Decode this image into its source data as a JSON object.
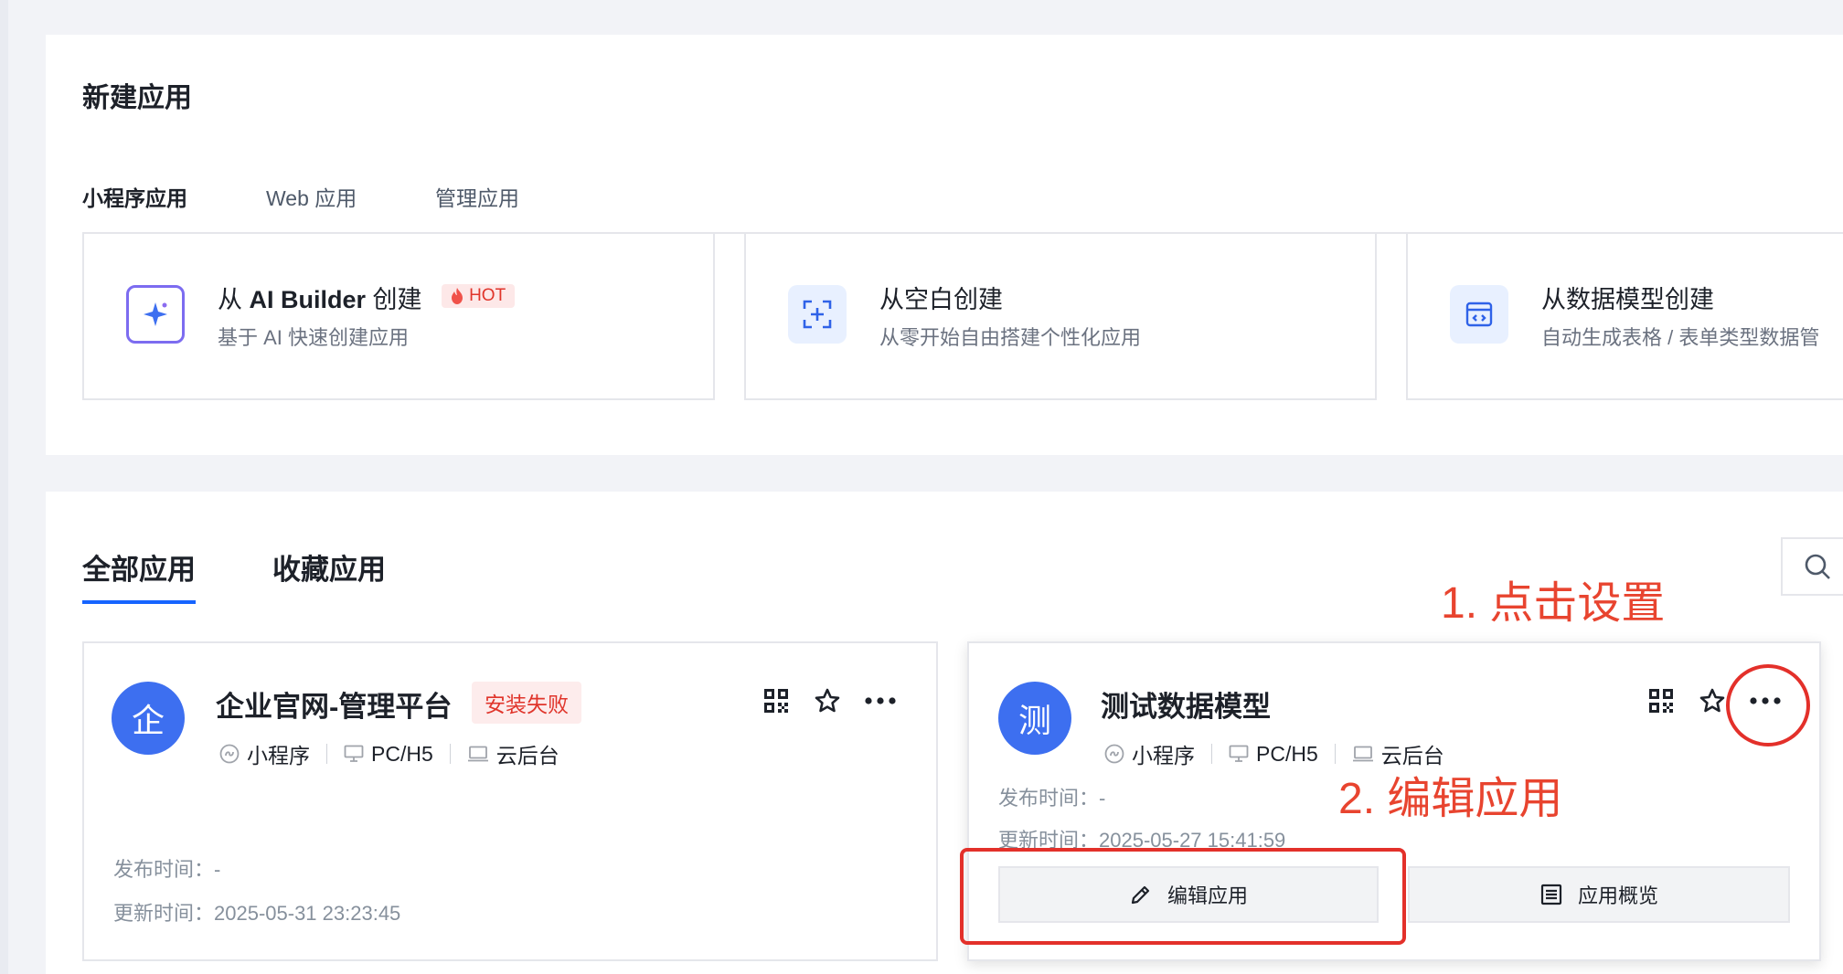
{
  "new_app": {
    "title": "新建应用",
    "tabs": [
      {
        "label": "小程序应用"
      },
      {
        "label": "Web 应用"
      },
      {
        "label": "管理应用"
      }
    ],
    "cards": [
      {
        "title_prefix": "从 ",
        "title_bold": "AI Builder",
        "title_suffix": " 创建",
        "badge": "HOT",
        "desc": "基于 AI 快速创建应用",
        "icon": "sparkle-icon"
      },
      {
        "title": "从空白创建",
        "desc": "从零开始自由搭建个性化应用",
        "icon": "add-frame-icon"
      },
      {
        "title": "从数据模型创建",
        "desc": "自动生成表格 / 表单类型数据管",
        "icon": "data-model-icon"
      }
    ]
  },
  "apps_section": {
    "tabs": [
      {
        "label": "全部应用"
      },
      {
        "label": "收藏应用"
      }
    ],
    "cards": [
      {
        "avatar": "企",
        "name": "企业官网-管理平台",
        "status": "安装失败",
        "platforms": [
          "小程序",
          "PC/H5",
          "云后台"
        ],
        "published": "发布时间：-",
        "updated": "更新时间：2025-05-31 23:23:45"
      },
      {
        "avatar": "测",
        "name": "测试数据模型",
        "platforms": [
          "小程序",
          "PC/H5",
          "云后台"
        ],
        "published": "发布时间：-",
        "updated": "更新时间：2025-05-27 15:41:59",
        "actions": {
          "edit": "编辑应用",
          "overview": "应用概览"
        }
      }
    ]
  },
  "annotations": {
    "step1": "1. 点击设置",
    "step2": "2. 编辑应用"
  },
  "colors": {
    "accent": "#1664ff",
    "avatar": "#3d6ff0",
    "annotation": "#e3302a",
    "fail": "#e0352b"
  }
}
